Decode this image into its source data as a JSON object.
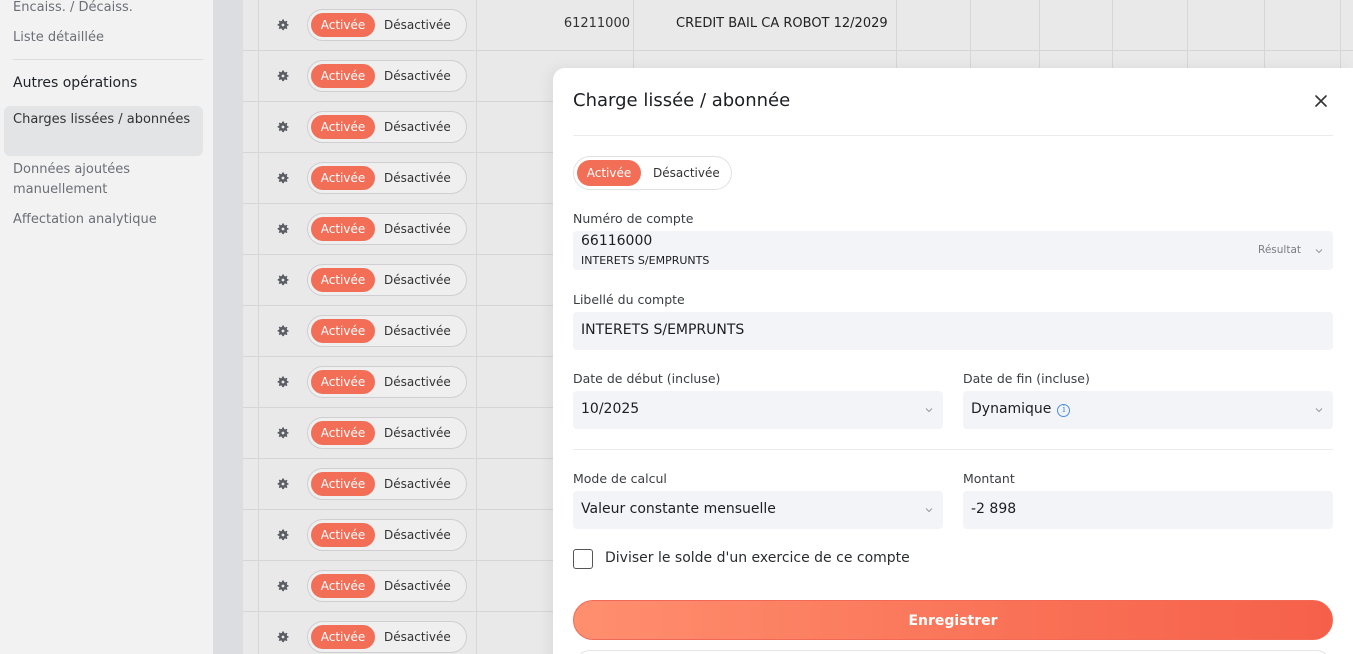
{
  "sidebar": {
    "items_top": [
      {
        "label": "Encaiss. / Décaiss."
      },
      {
        "label": "Liste détaillée"
      }
    ],
    "section_heading": "Autres opérations",
    "active_item": "Charges lissées / abonnées",
    "items_bottom": [
      {
        "label": "Données ajoutées manuellement"
      },
      {
        "label": "Affectation analytique"
      }
    ]
  },
  "table": {
    "toggle_on_label": "Activée",
    "toggle_off_label": "Désactivée",
    "first_row": {
      "account_number": "61211000",
      "account_label": "CREDIT BAIL CA ROBOT 12/2029"
    }
  },
  "modal": {
    "title": "Charge lissée / abonnée",
    "toggle_on_label": "Activée",
    "toggle_off_label": "Désactivée",
    "account_number_label": "Numéro de compte",
    "account_number_value": "66116000",
    "account_number_sub": "INTERETS S/EMPRUNTS",
    "account_type_tag": "Résultat",
    "account_label_label": "Libellé du compte",
    "account_label_value": "INTERETS S/EMPRUNTS",
    "start_date_label": "Date de début (incluse)",
    "start_date_value": "10/2025",
    "end_date_label": "Date de fin (incluse)",
    "end_date_value": "Dynamique",
    "calc_mode_label": "Mode de calcul",
    "calc_mode_value": "Valeur constante mensuelle",
    "amount_label": "Montant",
    "amount_value": "-2 898",
    "split_checkbox_label": "Diviser le solde d'un exercice de ce compte",
    "save_label": "Enregistrer"
  },
  "colors": {
    "accent": "#f26e57",
    "info": "#4a8fe0"
  }
}
